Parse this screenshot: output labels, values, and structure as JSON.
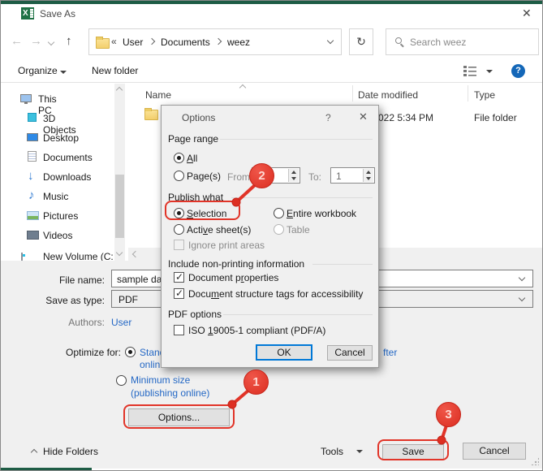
{
  "titlebar": {
    "title": "Save As",
    "close_glyph": "✕"
  },
  "nav": {
    "breadcrumb_root_glyph": "«",
    "crumbs": [
      "User",
      "Documents",
      "weez"
    ],
    "search_placeholder": "Search weez",
    "refresh_glyph": "↻"
  },
  "toolbar": {
    "organize": "Organize",
    "new_folder": "New folder"
  },
  "sidebar": {
    "items": [
      {
        "label": "This PC",
        "icon": "computer-icon"
      },
      {
        "label": "3D Objects",
        "icon": "cube-icon"
      },
      {
        "label": "Desktop",
        "icon": "desktop-icon"
      },
      {
        "label": "Documents",
        "icon": "documents-icon"
      },
      {
        "label": "Downloads",
        "icon": "downloads-icon",
        "glyph": "↓"
      },
      {
        "label": "Music",
        "icon": "music-icon",
        "glyph": "♪"
      },
      {
        "label": "Pictures",
        "icon": "pictures-icon"
      },
      {
        "label": "Videos",
        "icon": "videos-icon"
      },
      {
        "label": "New Volume (C:",
        "icon": "drive-icon"
      }
    ]
  },
  "filelist": {
    "columns": [
      "Name",
      "Date modified",
      "Type"
    ],
    "row": {
      "date_modified": "022 5:34 PM",
      "type": "File folder"
    }
  },
  "form": {
    "file_name_label": "File name:",
    "file_name_value": "sample data",
    "save_as_type_label": "Save as type:",
    "save_as_type_value": "PDF",
    "authors_label": "Authors:",
    "authors_value": "User",
    "optimize_label": "Optimize for:",
    "standard_fragment_line1": "Stand",
    "standard_fragment_line2": "onlin",
    "open_file_fragment": "fter",
    "minimum_line1": "Minimum size",
    "minimum_line2": "(publishing online)",
    "options_button": "Options..."
  },
  "bottombar": {
    "hide_folders": "Hide Folders",
    "tools": "Tools",
    "save": "Save",
    "cancel": "Cancel"
  },
  "dialog": {
    "title": "Options",
    "help_glyph": "?",
    "close_glyph": "✕",
    "page_range": {
      "heading": "Page range",
      "all": {
        "pre": "",
        "accel": "A",
        "post": "ll"
      },
      "pages": {
        "pre": "Pa",
        "accel": "g",
        "post": "e(s)"
      },
      "from_label": "From:",
      "to_label": "To:",
      "to_value": "1"
    },
    "publish_what": {
      "heading": "Publish what",
      "selection": {
        "pre": "",
        "accel": "S",
        "post": "election"
      },
      "entire_workbook": {
        "pre": "",
        "accel": "E",
        "post": "ntire workbook"
      },
      "active_sheets": {
        "pre": "Acti",
        "accel": "v",
        "post": "e sheet(s)"
      },
      "table": "Table",
      "ignore_print_areas": "Ignore print areas"
    },
    "non_printing": {
      "heading": "Include non-printing information",
      "doc_properties": {
        "pre": "Document p",
        "accel": "r",
        "post": "operties"
      },
      "doc_structure": {
        "pre": "Docu",
        "accel": "m",
        "post": "ent structure tags for accessibility"
      }
    },
    "pdf_options": {
      "heading": "PDF options",
      "iso": {
        "pre": "ISO ",
        "accel": "1",
        "post": "9005-1 compliant (PDF/A)"
      }
    },
    "ok": "OK",
    "cancel": "Cancel"
  },
  "callouts": {
    "step1": "1",
    "step2": "2",
    "step3": "3"
  },
  "colors": {
    "excel_green": "#1e5c45",
    "callout_red": "#e13428",
    "link_blue": "#2468c5",
    "default_button_blue": "#0078d7",
    "help_blue": "#1467b8",
    "folder_yellow": "#f8d775"
  }
}
